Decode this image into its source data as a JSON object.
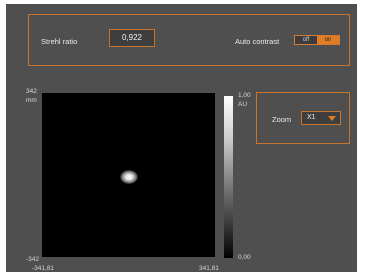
{
  "strehl": {
    "label": "Strehl ratio",
    "value": "0,922"
  },
  "auto_contrast": {
    "label": "Auto contrast",
    "off_label": "off",
    "on_label": "on",
    "state": "on"
  },
  "plot": {
    "y_max": "342",
    "y_unit": "mm",
    "y_min": "-342",
    "x_min": "-341,81",
    "x_max": "341,81"
  },
  "colorbar": {
    "max_label": "1,00",
    "unit": "AU",
    "min_label": "0,00"
  },
  "zoom": {
    "label": "Zoom",
    "value": "X1",
    "dropdown_icon": "caret-down-icon"
  },
  "colors": {
    "accent": "#e07e26",
    "background": "#4f4f4f"
  }
}
